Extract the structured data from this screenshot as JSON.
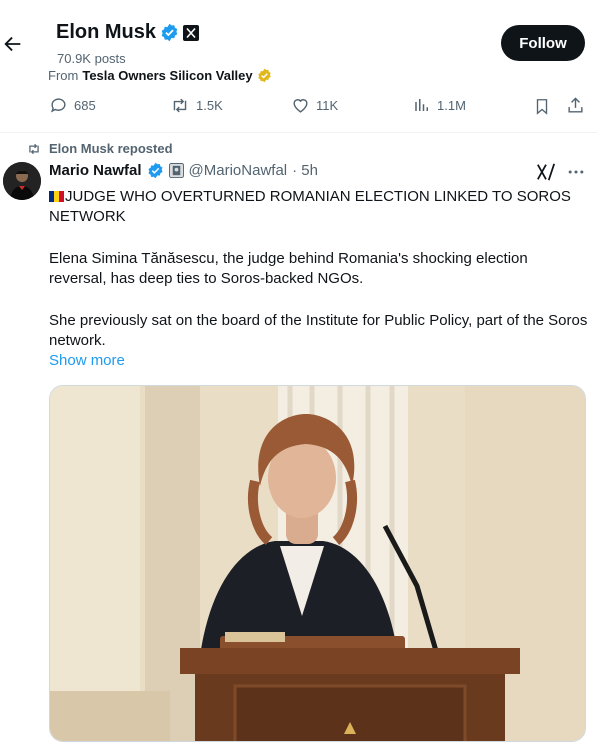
{
  "header": {
    "name": "Elon Musk",
    "posts_count": "70.9K posts",
    "follow_label": "Follow"
  },
  "from_line": {
    "prefix": "From",
    "source": "Tesla Owners Silicon Valley"
  },
  "parent_actions": {
    "replies": "685",
    "reposts": "1.5K",
    "likes": "11K",
    "views": "1.1M"
  },
  "repost": {
    "label": "Elon Musk reposted"
  },
  "tweet": {
    "author_name": "Mario Nawfal",
    "handle": "@MarioNawfal",
    "time": "· 5h",
    "headline": "JUDGE WHO OVERTURNED ROMANIAN ELECTION LINKED TO SOROS NETWORK",
    "paragraph_1": "Elena Simina Tănăsescu, the judge behind Romania's shocking election reversal, has deep ties to Soros-backed NGOs.",
    "paragraph_2": "She previously sat on the board of the Institute for Public Policy, part of the Soros network.",
    "show_more": "Show more"
  },
  "colors": {
    "accent_blue": "#1d9bf0",
    "verified_blue": "#1d9bf0",
    "verified_gold": "#e2b719",
    "text_primary": "#0f1419",
    "text_secondary": "#536471"
  },
  "icons": {
    "back": "arrow-left-icon",
    "verified": "verified-badge-icon",
    "x_logo": "x-logo-icon",
    "reply": "reply-icon",
    "repost": "repost-icon",
    "like": "heart-icon",
    "views": "views-icon",
    "bookmark": "bookmark-icon",
    "share": "share-icon",
    "grok": "grok-icon",
    "more": "more-icon"
  }
}
